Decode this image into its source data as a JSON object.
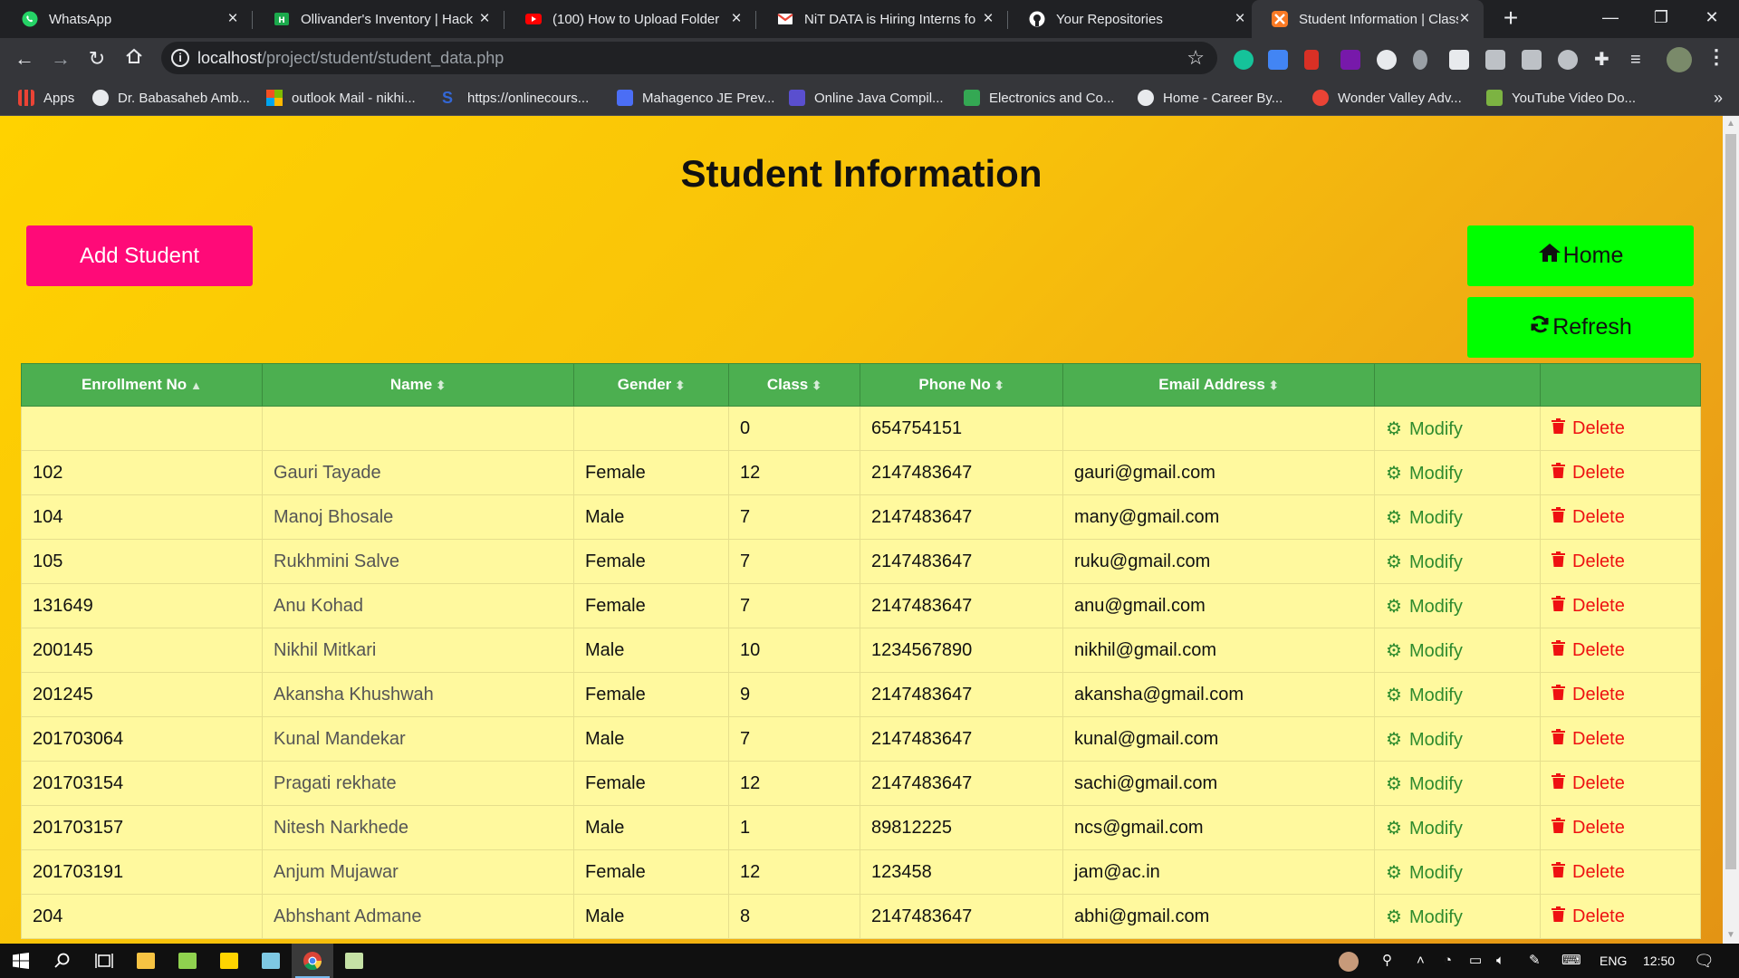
{
  "browser": {
    "tabs": [
      {
        "title": "WhatsApp",
        "favicon_color": "#25d366"
      },
      {
        "title": "Ollivander's Inventory | Hack",
        "favicon_color": "#1ba94c"
      },
      {
        "title": "(100) How to Upload Folder",
        "favicon_color": "#ff0000"
      },
      {
        "title": "NiT DATA is Hiring Interns fo",
        "favicon_color": "#ea4335"
      },
      {
        "title": "Your Repositories",
        "favicon_color": "#ffffff"
      },
      {
        "title": "Student Information | Class M",
        "favicon_color": "#fb7a24",
        "active": true
      }
    ],
    "url_host": "localhost",
    "url_path": "/project/student/student_data.php",
    "bookmarks": [
      {
        "label": "Apps",
        "icon_color": "#ea4335"
      },
      {
        "label": "Dr. Babasaheb Amb...",
        "icon_color": "#e8eaed"
      },
      {
        "label": "outlook Mail - nikhi...",
        "icon_color": "#f25022"
      },
      {
        "label": "https://onlinecours...",
        "icon_color": "#3367d6"
      },
      {
        "label": "Mahagenco JE Prev...",
        "icon_color": "#4b6ef5"
      },
      {
        "label": "Online Java Compil...",
        "icon_color": "#5a4fcf"
      },
      {
        "label": "Electronics and Co...",
        "icon_color": "#34a853"
      },
      {
        "label": "Home - Career By...",
        "icon_color": "#e8eaed"
      },
      {
        "label": "Wonder Valley Adv...",
        "icon_color": "#ea4335"
      },
      {
        "label": "YouTube Video Do...",
        "icon_color": "#7cb342"
      }
    ],
    "bookmarks_more": "»"
  },
  "page": {
    "title": "Student Information",
    "add_button": "Add Student",
    "home_button": "Home",
    "refresh_button": "Refresh"
  },
  "table": {
    "columns": [
      "Enrollment No",
      "Name",
      "Gender",
      "Class",
      "Phone No",
      "Email Address"
    ],
    "modify_label": "Modify",
    "delete_label": "Delete",
    "rows": [
      {
        "enrollment": "",
        "name": "",
        "gender": "",
        "class": "0",
        "phone": "654754151",
        "email": ""
      },
      {
        "enrollment": "102",
        "name": "Gauri Tayade",
        "gender": "Female",
        "class": "12",
        "phone": "2147483647",
        "email": "gauri@gmail.com"
      },
      {
        "enrollment": "104",
        "name": "Manoj Bhosale",
        "gender": "Male",
        "class": "7",
        "phone": "2147483647",
        "email": "many@gmail.com"
      },
      {
        "enrollment": "105",
        "name": "Rukhmini Salve",
        "gender": "Female",
        "class": "7",
        "phone": "2147483647",
        "email": "ruku@gmail.com"
      },
      {
        "enrollment": "131649",
        "name": "Anu Kohad",
        "gender": "Female",
        "class": "7",
        "phone": "2147483647",
        "email": "anu@gmail.com"
      },
      {
        "enrollment": "200145",
        "name": "Nikhil Mitkari",
        "gender": "Male",
        "class": "10",
        "phone": "1234567890",
        "email": "nikhil@gmail.com"
      },
      {
        "enrollment": "201245",
        "name": "Akansha Khushwah",
        "gender": "Female",
        "class": "9",
        "phone": "2147483647",
        "email": "akansha@gmail.com"
      },
      {
        "enrollment": "201703064",
        "name": "Kunal Mandekar",
        "gender": "Male",
        "class": "7",
        "phone": "2147483647",
        "email": "kunal@gmail.com"
      },
      {
        "enrollment": "201703154",
        "name": "Pragati rekhate",
        "gender": "Female",
        "class": "12",
        "phone": "2147483647",
        "email": "sachi@gmail.com"
      },
      {
        "enrollment": "201703157",
        "name": "Nitesh Narkhede",
        "gender": "Male",
        "class": "1",
        "phone": "89812225",
        "email": "ncs@gmail.com"
      },
      {
        "enrollment": "201703191",
        "name": "Anjum Mujawar",
        "gender": "Female",
        "class": "12",
        "phone": "123458",
        "email": "jam@ac.in"
      },
      {
        "enrollment": "204",
        "name": "Abhshant Admane",
        "gender": "Male",
        "class": "8",
        "phone": "2147483647",
        "email": "abhi@gmail.com"
      }
    ]
  },
  "taskbar": {
    "language": "ENG",
    "time": "12:50"
  },
  "colors": {
    "page_gradient_start": "#ffd200",
    "page_gradient_end": "#e39414",
    "add_button": "#ff0a78",
    "green_button": "#00ff00",
    "table_header": "#4caf50",
    "table_row": "#fff99e",
    "modify": "#2e8b2e",
    "delete": "#ee1111"
  }
}
